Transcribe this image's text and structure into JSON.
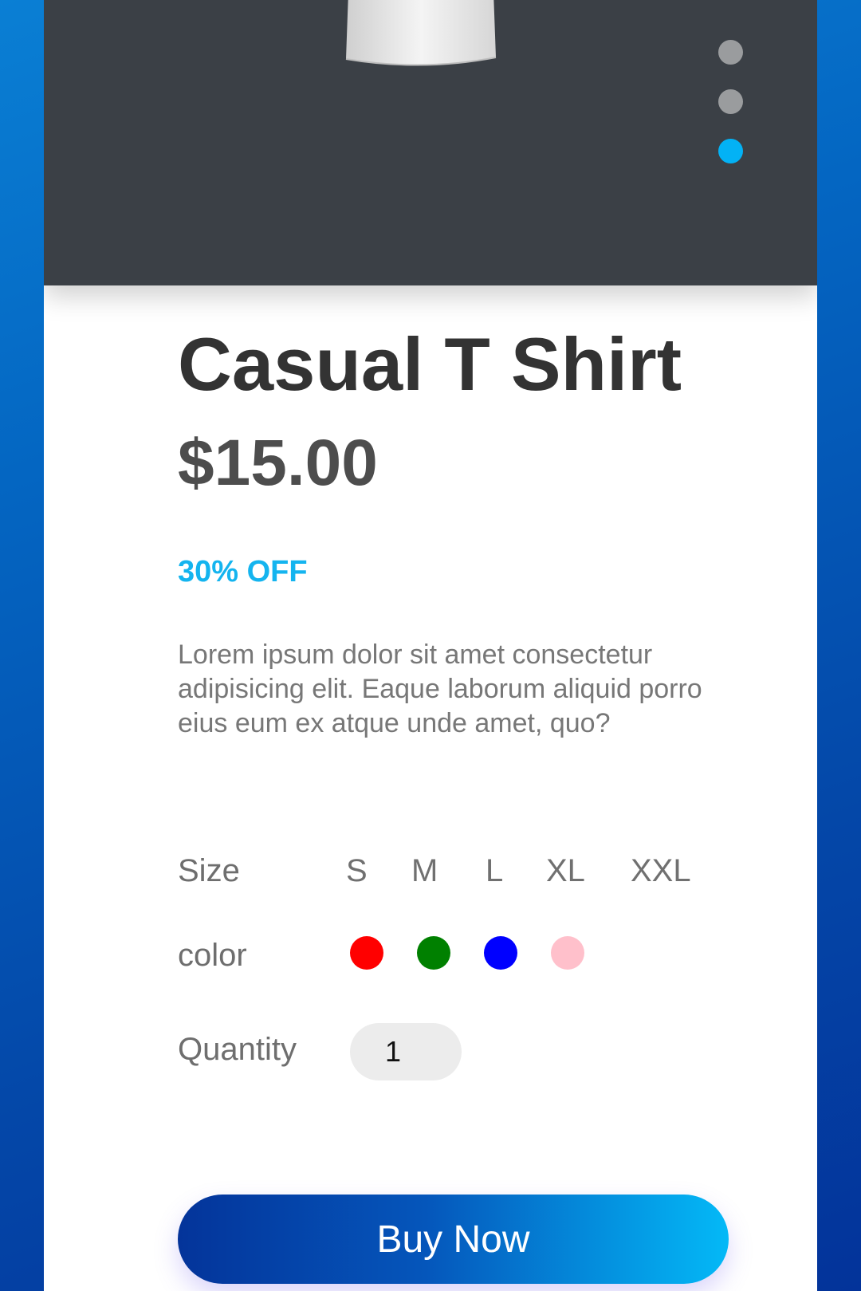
{
  "product": {
    "image_alt": "t-shirt-image",
    "title": "Casual T Shirt",
    "price": "$15.00",
    "discount": "30% OFF",
    "description": "Lorem ipsum dolor sit amet consectetur adipisicing elit. Eaque laborum aliquid porro eius eum ex atque unde amet, quo?"
  },
  "carousel": {
    "slide_count": 3,
    "active_index": 2,
    "active_color": "#03b2f5",
    "inactive_color": "#9a9c9e"
  },
  "options": {
    "size_label": "Size",
    "sizes": [
      "S",
      "M",
      "L",
      "XL",
      "XXL"
    ],
    "color_label": "color",
    "colors": [
      "#ff0000",
      "#008000",
      "#0000ff",
      "#ffc0cb"
    ],
    "quantity_label": "Quantity",
    "quantity_value": "1"
  },
  "actions": {
    "buy_label": "Buy Now"
  },
  "theme": {
    "accent": "#14b4ef",
    "background": "#0466c2",
    "hero_background": "#3b4046"
  }
}
